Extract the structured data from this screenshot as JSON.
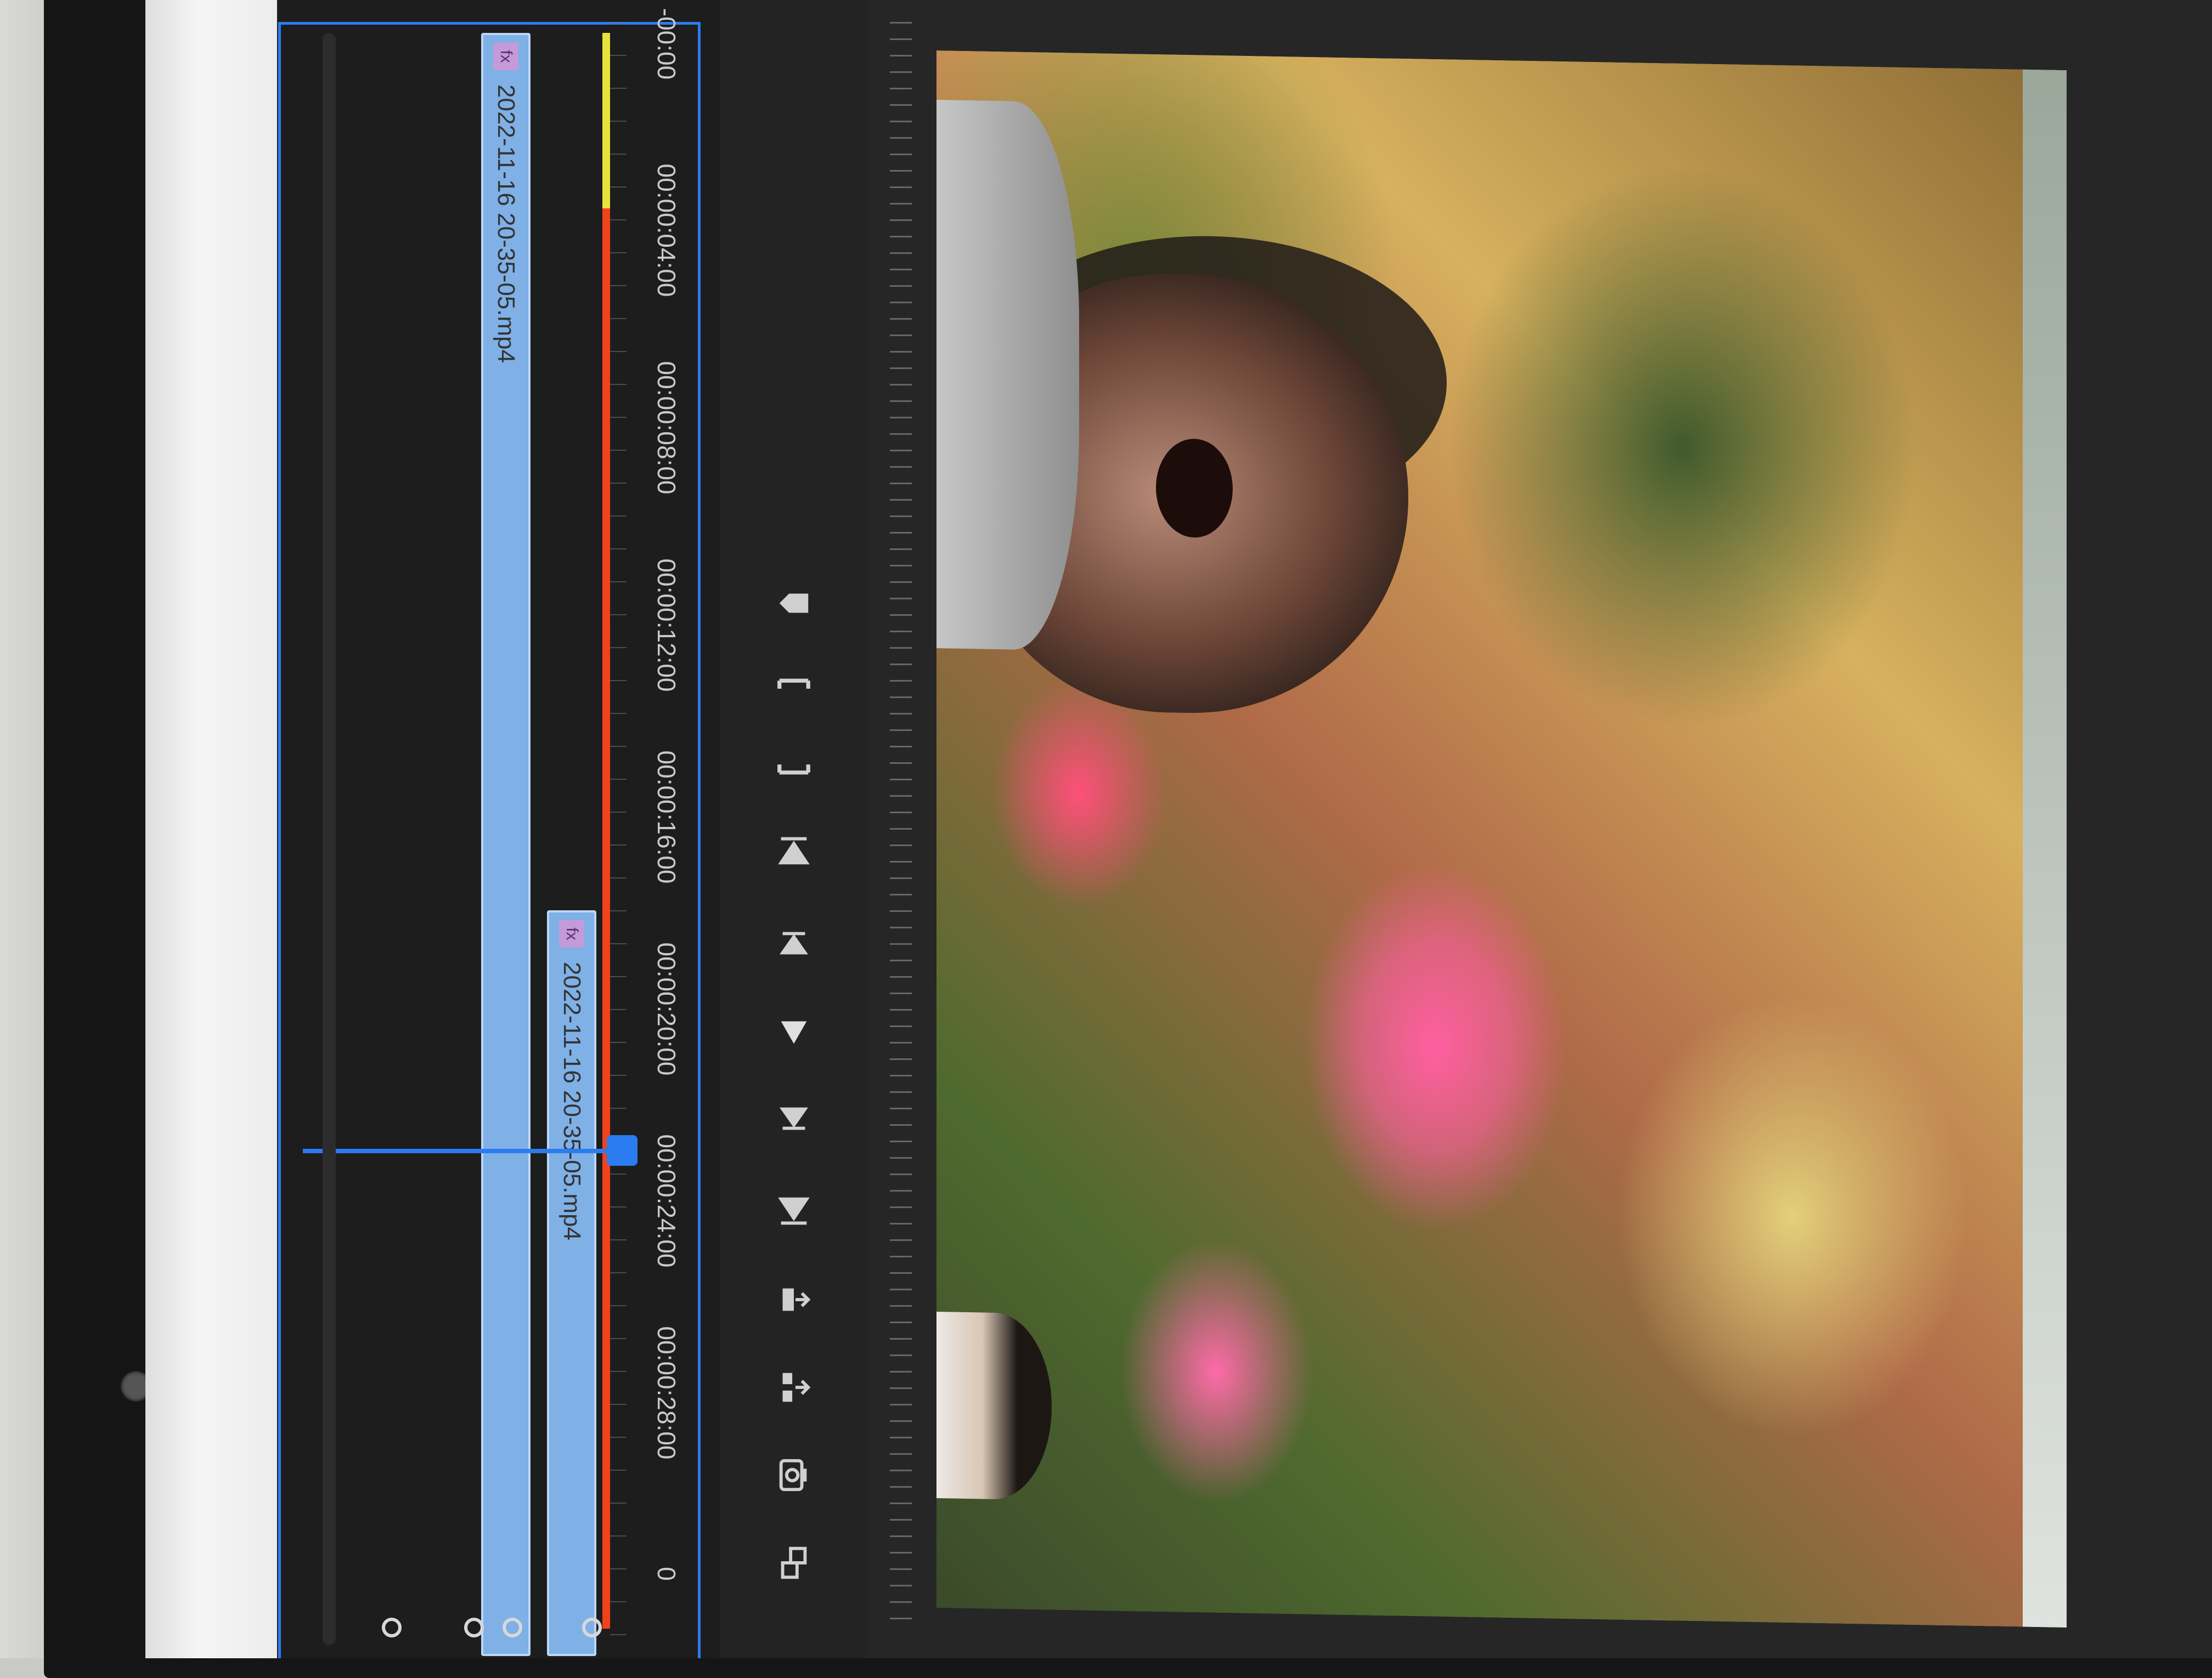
{
  "timeline": {
    "timecodes": [
      "-00:00",
      "00:00:04:00",
      "00:00:08:00",
      "00:00:12:00",
      "00:00:16:00",
      "00:00:20:00",
      "00:00:24:00",
      "00:00:28:00",
      "0"
    ],
    "clips": [
      {
        "label": "2022-11-16 20-35-05.mp4",
        "fx": "fx"
      },
      {
        "label": "2022-11-16 20-35-05.mp4",
        "fx": "fx"
      }
    ]
  },
  "transport": {
    "buttons": [
      "add-marker-icon",
      "mark-in-icon",
      "mark-out-icon",
      "go-to-in-icon",
      "step-back-icon",
      "play-icon",
      "step-forward-icon",
      "go-to-out-icon",
      "lift-icon",
      "extract-icon",
      "export-frame-icon",
      "comparison-view-icon"
    ]
  },
  "colors": {
    "accent": "#2b7cf0",
    "render_yellow": "#e9e23a",
    "render_red": "#f0421c",
    "clip": "#7fb0e6"
  }
}
